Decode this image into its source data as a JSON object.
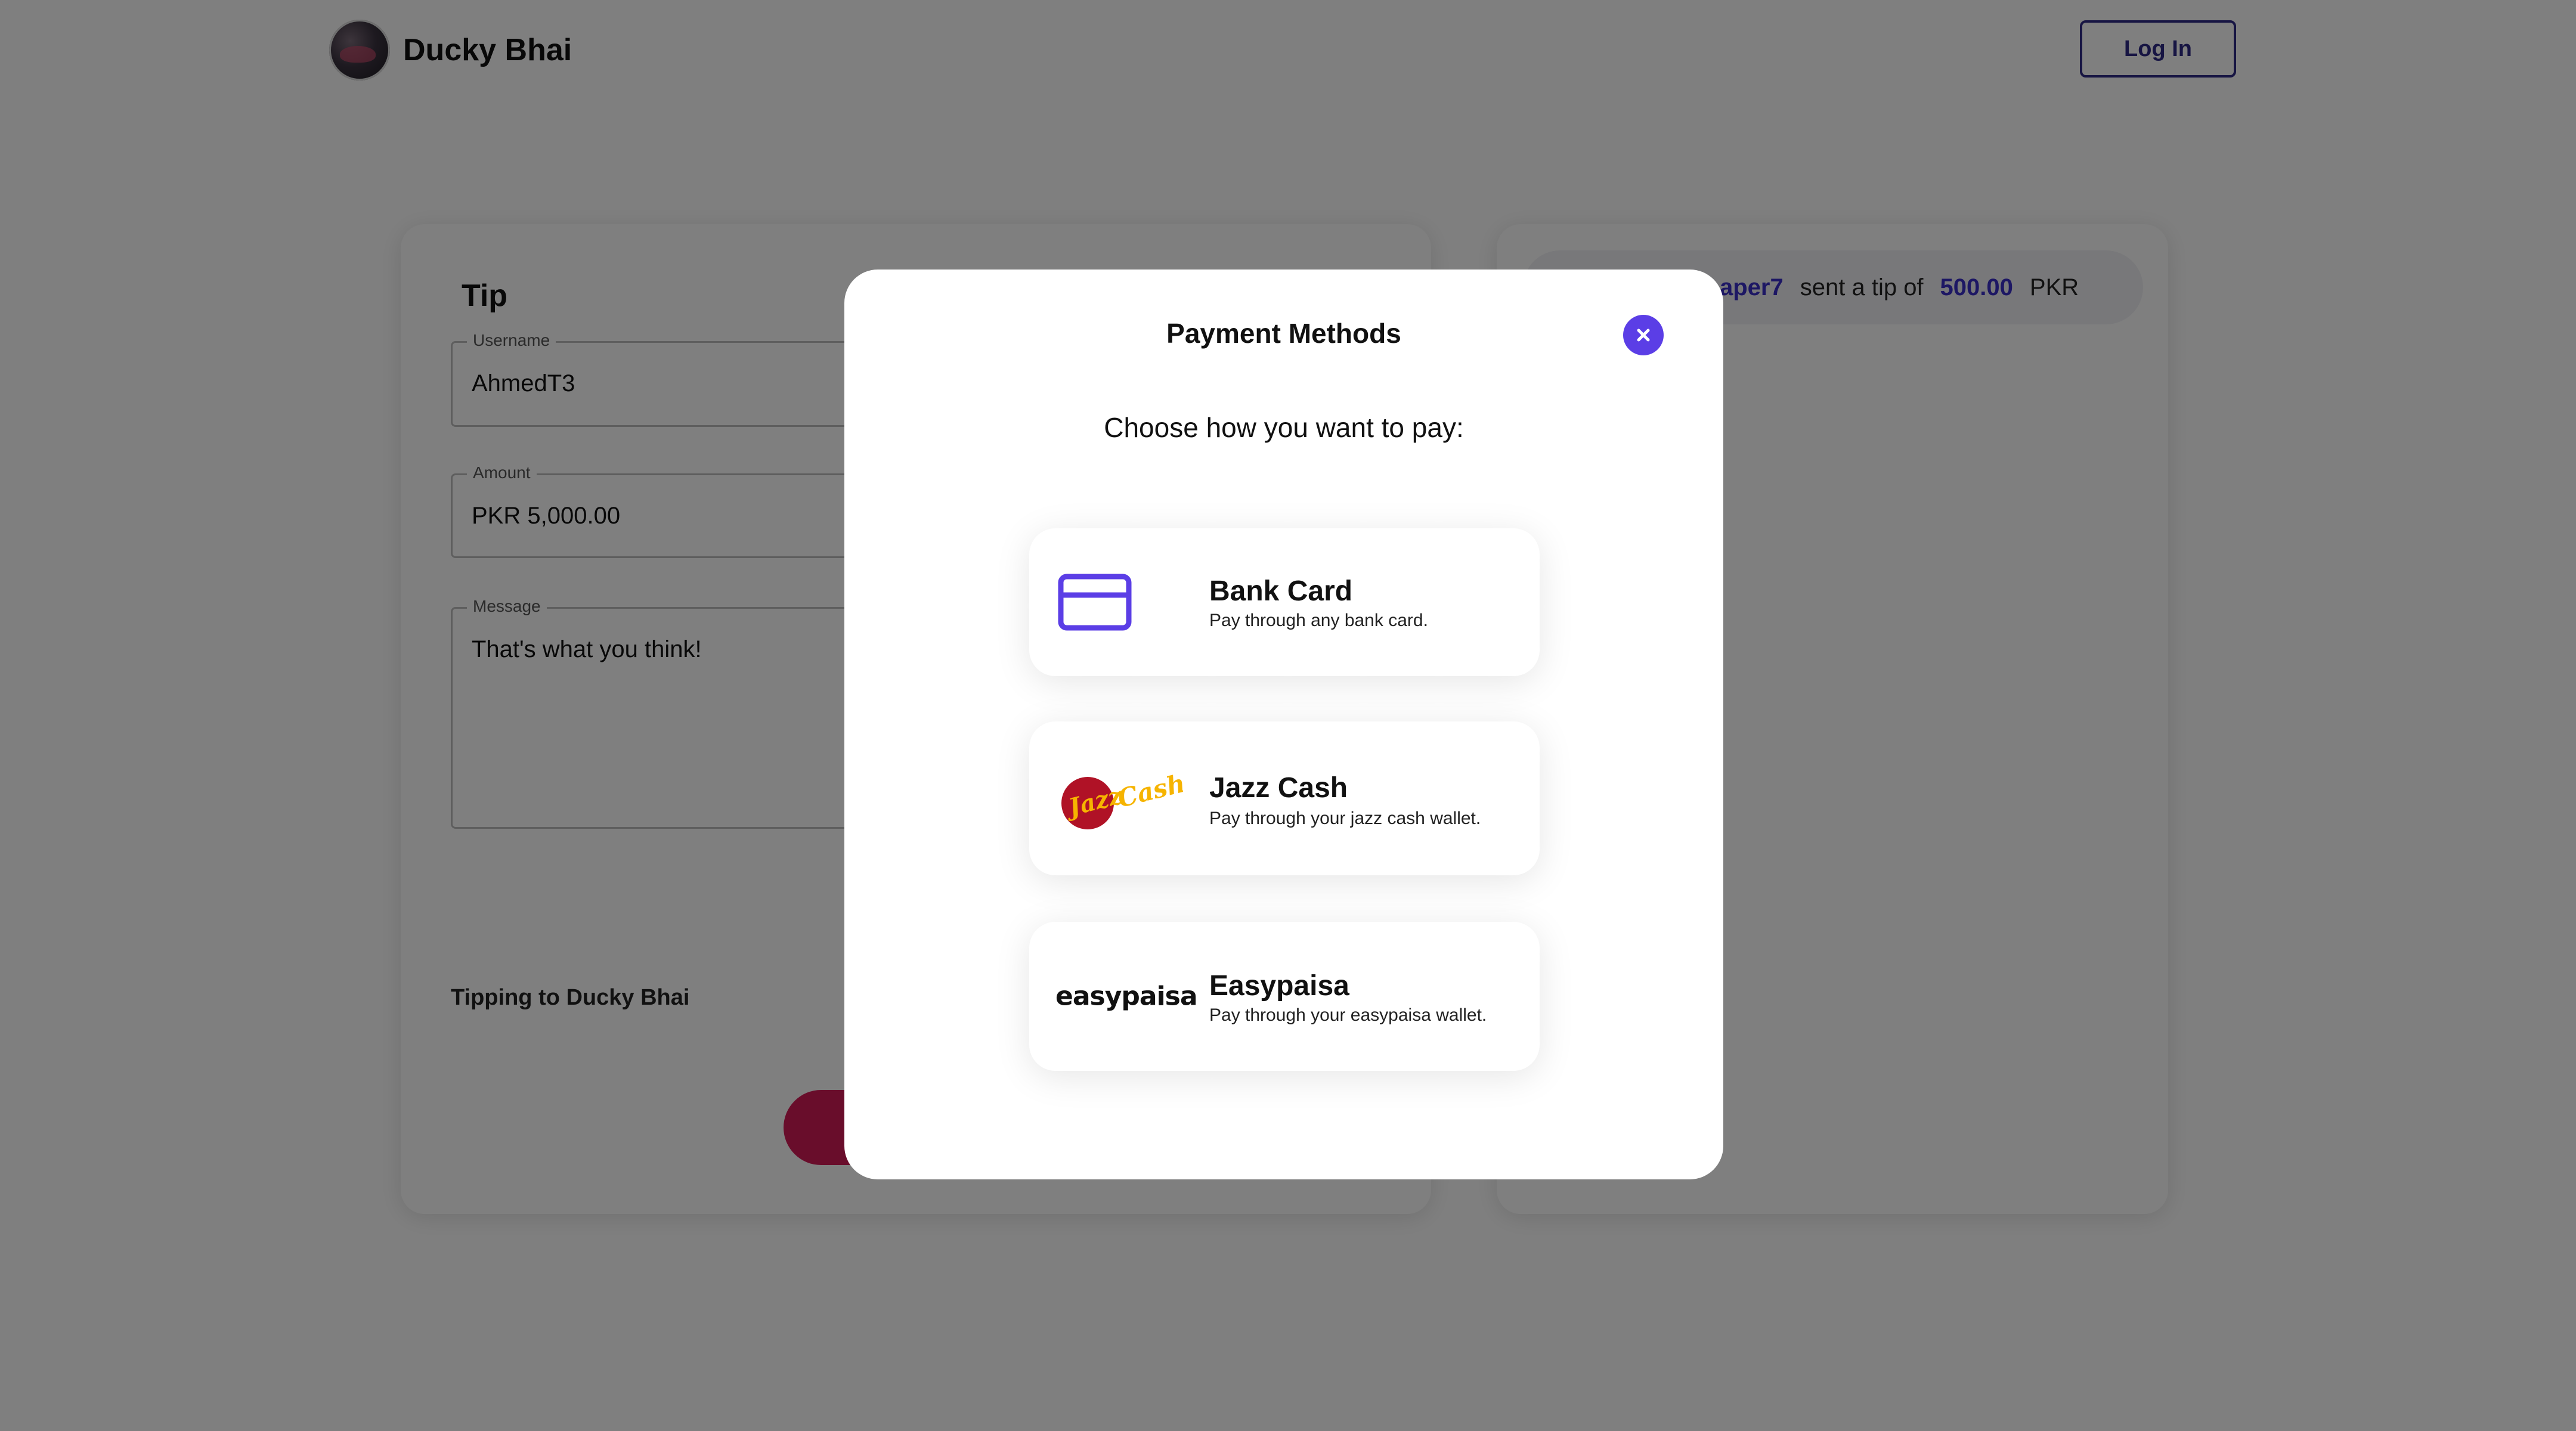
{
  "header": {
    "brand_name": "Ducky Bhai",
    "login_label": "Log In"
  },
  "tip_form": {
    "title": "Tip",
    "username": {
      "label": "Username",
      "value": "AhmedT3"
    },
    "amount": {
      "label": "Amount",
      "value": "PKR  5,000.00"
    },
    "message": {
      "label": "Message",
      "value": "That's what you think!"
    },
    "tipping_to": "Tipping to Ducky Bhai"
  },
  "feed": {
    "items": [
      {
        "user": "aper7",
        "text": "sent a tip of",
        "amount": "500.00",
        "currency": "PKR"
      }
    ]
  },
  "modal": {
    "title": "Payment Methods",
    "subtitle": "Choose how you want to pay:",
    "methods": [
      {
        "name": "Bank Card",
        "description": "Pay through any bank card.",
        "icon": "credit-card-icon"
      },
      {
        "name": "Jazz Cash",
        "description": "Pay through your jazz cash wallet.",
        "icon": "jazzcash-logo"
      },
      {
        "name": "Easypaisa",
        "description": "Pay through your easypaisa wallet.",
        "icon": "easypaisa-logo",
        "logo_text": "easypaisa"
      }
    ],
    "jazz_logo_text": {
      "jazz": "Jazz",
      "cash": "Cash"
    }
  },
  "colors": {
    "accent": "#5b3ee6",
    "brand_blue": "#2e2a86",
    "send_button": "#d21b57",
    "jazz_red": "#b01226",
    "jazz_yellow": "#f6b400"
  }
}
